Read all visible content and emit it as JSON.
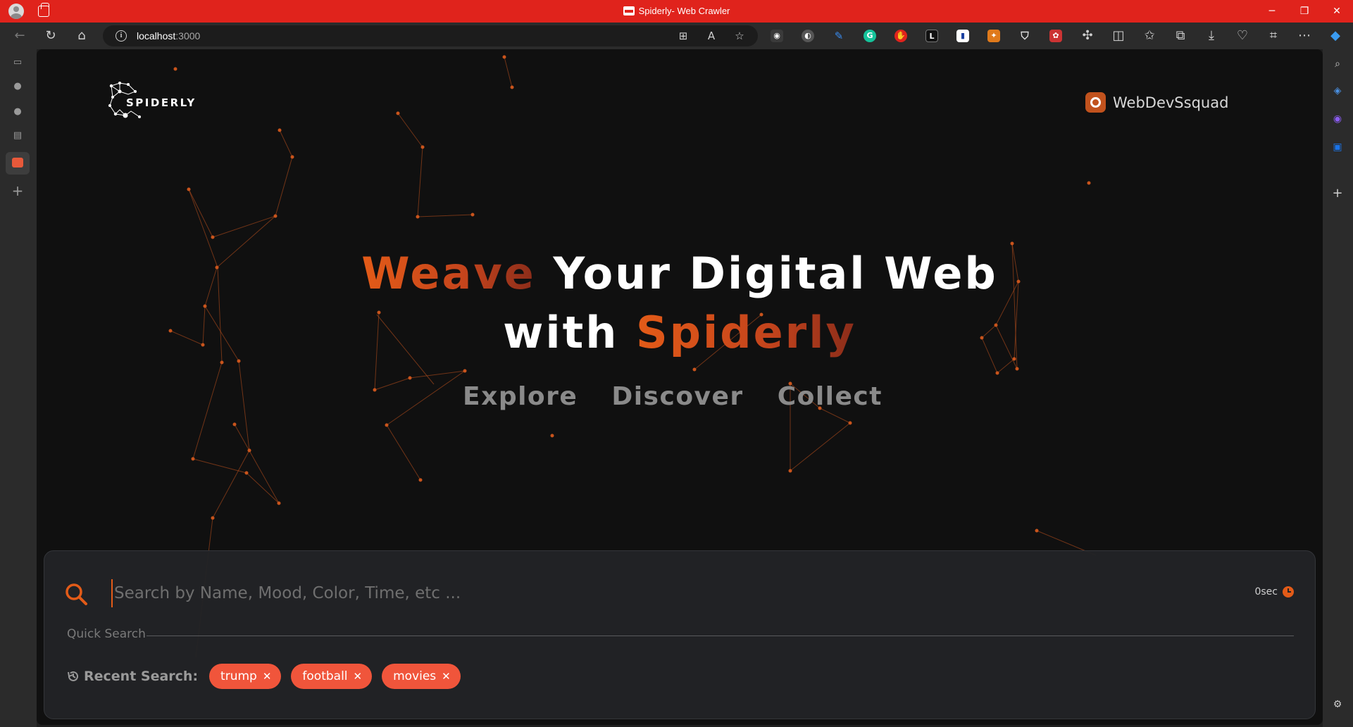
{
  "browser": {
    "window_title": "Spiderly- Web Crawler",
    "url_host": "localhost",
    "url_port": ":3000",
    "accent_color": "#e0231c"
  },
  "app": {
    "logo_text": "SPIDERLY",
    "github_link_text": "WebDevSsquad",
    "hero_line1_accent": "Weave",
    "hero_line1_rest": "Your Digital Web",
    "hero_line2_prefix": "with",
    "hero_line2_accent": "Spiderly",
    "tagline": [
      "Explore",
      "Discover",
      "Collect"
    ],
    "accent_color": "#e35b18"
  },
  "search": {
    "placeholder": "Search by Name, Mood, Color, Time, etc ...",
    "value": "",
    "timer": "0sec",
    "quick_search_label": "Quick Search",
    "recent_label": "Recent Search:",
    "recent": [
      "trump",
      "football",
      "movies"
    ]
  }
}
